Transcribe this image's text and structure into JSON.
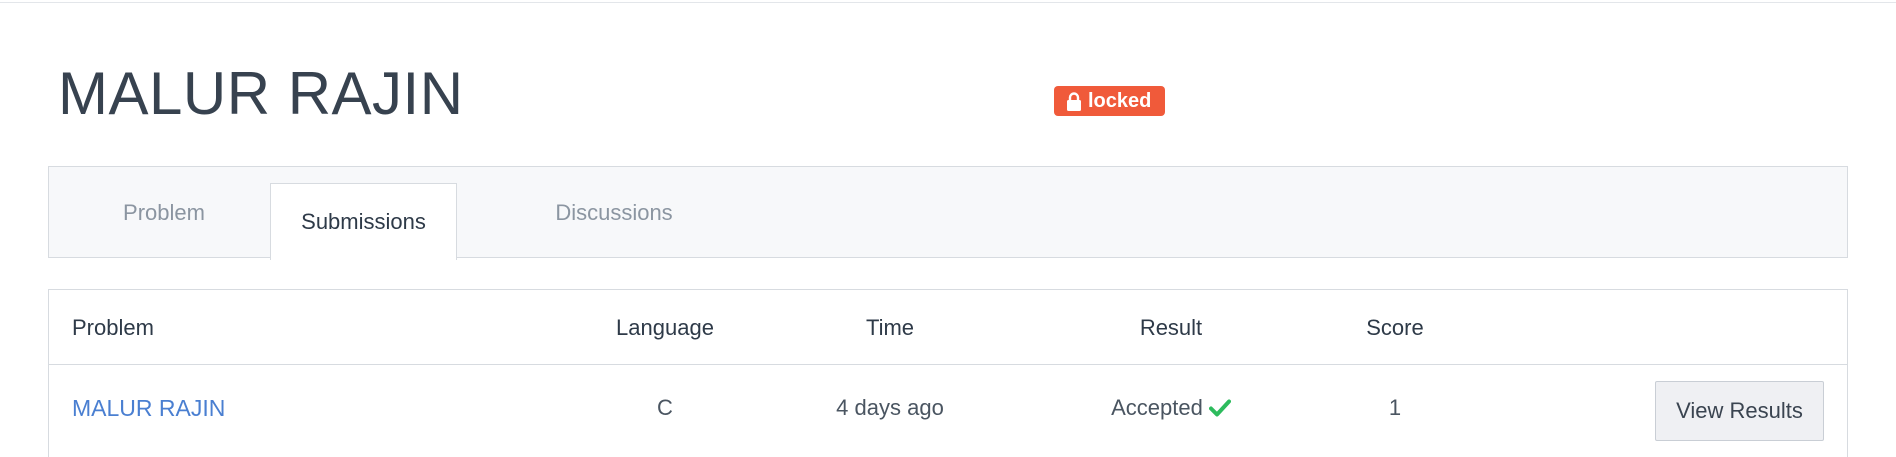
{
  "header": {
    "title": "MALUR RAJIN",
    "badge": {
      "label": "locked",
      "icon": "lock-icon",
      "color": "#f05a3a"
    }
  },
  "tabs": [
    {
      "label": "Problem",
      "active": false
    },
    {
      "label": "Submissions",
      "active": true
    },
    {
      "label": "Discussions",
      "active": false
    }
  ],
  "submissions": {
    "columns": [
      "Problem",
      "Language",
      "Time",
      "Result",
      "Score"
    ],
    "rows": [
      {
        "problem": "MALUR RAJIN",
        "language": "C",
        "time": "4 days ago",
        "result": "Accepted",
        "result_icon": "check-icon",
        "result_color": "#2dbb5d",
        "score": "1",
        "action_label": "View Results"
      }
    ]
  },
  "colors": {
    "link": "#4a7fd1",
    "badge": "#f05a3a",
    "accepted": "#2dbb5d"
  }
}
